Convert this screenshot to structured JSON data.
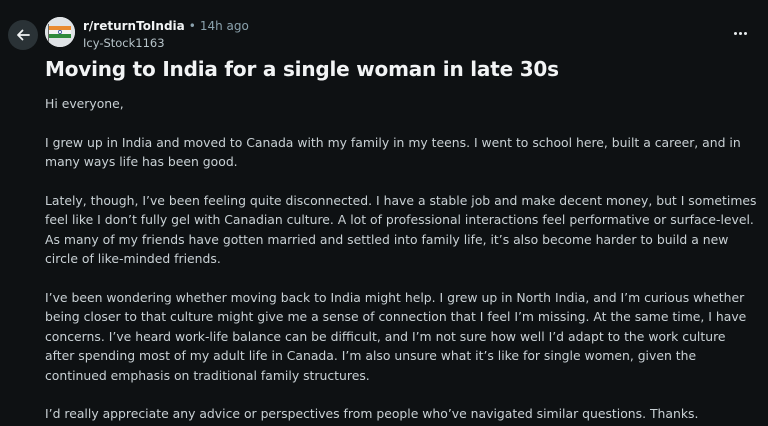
{
  "header": {
    "subreddit": "r/returnToIndia",
    "separator": "•",
    "time_ago": "14h ago",
    "author": "Icy-Stock1163"
  },
  "icons": {
    "back": "arrow-left-icon",
    "more": "more-horizontal-icon",
    "avatar": "india-flag-avatar"
  },
  "post": {
    "title": "Moving to India for a single woman in late 30s",
    "paragraphs": [
      "Hi everyone,",
      "I grew up in India and moved to Canada with my family in my teens. I went to school here, built a career, and in many ways life has been good.",
      "Lately, though, I’ve been feeling quite disconnected. I have a stable job and make decent money, but I sometimes feel like I don’t fully gel with Canadian culture. A lot of professional interactions feel performative or surface-level. As many of my friends have gotten married and settled into family life, it’s also become harder to build a new circle of like-minded friends.",
      "I’ve been wondering whether moving back to India might help. I grew up in North India, and I’m curious whether being closer to that culture might give me a sense of connection that I feel I’m missing. At the same time, I have concerns. I’ve heard work-life balance can be difficult, and I’m not sure how well I’d adapt to the work culture after spending most of my adult life in Canada. I’m also unsure what it’s like for single women, given the continued emphasis on traditional family structures.",
      "I’d really appreciate any advice or perspectives from people who’ve navigated similar questions. Thanks."
    ]
  },
  "colors": {
    "background": "#0e1113",
    "text": "#c9d1d5",
    "title": "#f2f4f5",
    "muted": "#8ba2ad"
  }
}
